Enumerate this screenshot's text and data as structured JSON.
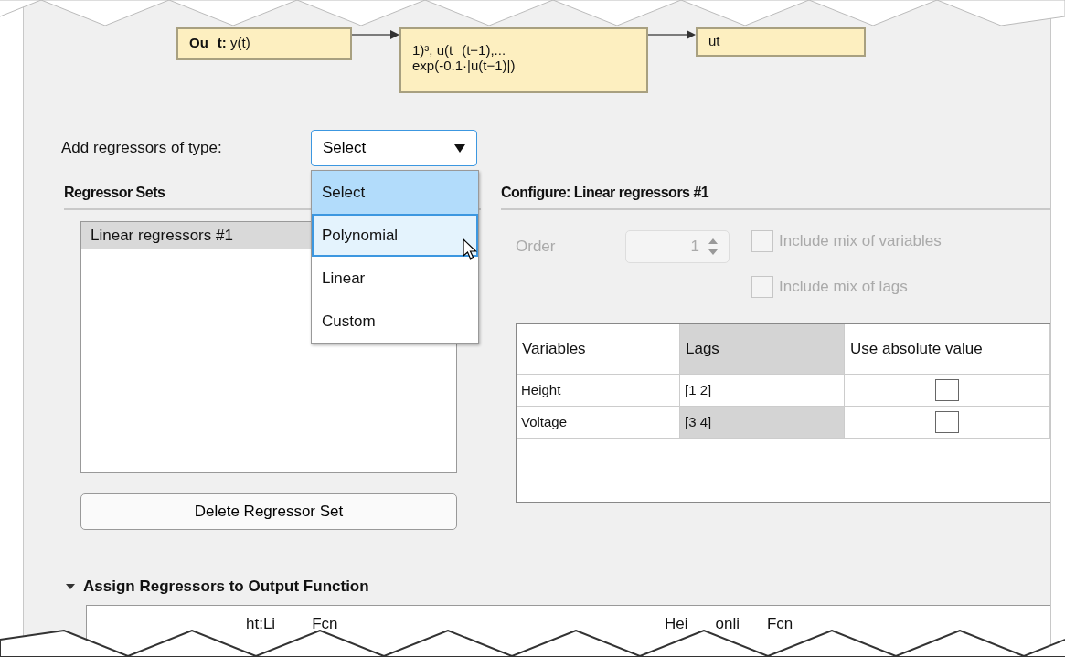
{
  "diagram": {
    "blocks": [
      {
        "lines": [
          [
            "**Ou**",
            "**t:** y(t)"
          ]
        ]
      },
      {
        "lines": [
          [
            "1)³, u(t",
            "(t−1),..."
          ],
          [
            "exp(-0.1·|u(t−1)|)"
          ]
        ]
      },
      {
        "lines": [
          [
            "ut"
          ]
        ]
      }
    ]
  },
  "regressor_type": {
    "label": "Add regressors of type:",
    "value": "Select",
    "expanded": true,
    "options": [
      {
        "label": "Select",
        "selected": true,
        "hovered": false
      },
      {
        "label": "Polynomial",
        "selected": false,
        "hovered": true
      },
      {
        "label": "Linear",
        "selected": false,
        "hovered": false
      },
      {
        "label": "Custom",
        "selected": false,
        "hovered": false
      }
    ]
  },
  "regressor_sets": {
    "title": "Regressor Sets",
    "items": [
      {
        "label": "Linear regressors #1",
        "selected": true
      }
    ],
    "delete_button": "Delete Regressor Set"
  },
  "configure": {
    "title": "Configure: Linear regressors #1",
    "order": {
      "label": "Order",
      "value": "1",
      "disabled": true
    },
    "checkboxes": [
      {
        "label": "Include mix of variables",
        "checked": false,
        "disabled": true
      },
      {
        "label": "Include mix of lags",
        "checked": false,
        "disabled": true
      }
    ],
    "table": {
      "columns": [
        {
          "label": "Variables",
          "selected": false
        },
        {
          "label": "Lags",
          "selected": true
        },
        {
          "label": "Use absolute value",
          "selected": false
        }
      ],
      "rows": [
        {
          "variable": "Height",
          "lags": "[1 2]",
          "lags_selected": false,
          "absolute": false
        },
        {
          "variable": "Voltage",
          "lags": "[3 4]",
          "lags_selected": true,
          "absolute": false
        }
      ]
    }
  },
  "assign": {
    "title": "Assign Regressors to Output Function",
    "expanded": true,
    "columns": [
      {
        "fragments": [
          "ht:Li",
          "Fcn"
        ]
      },
      {
        "fragments": [
          "Hei",
          "onli",
          "Fcn"
        ]
      }
    ]
  }
}
